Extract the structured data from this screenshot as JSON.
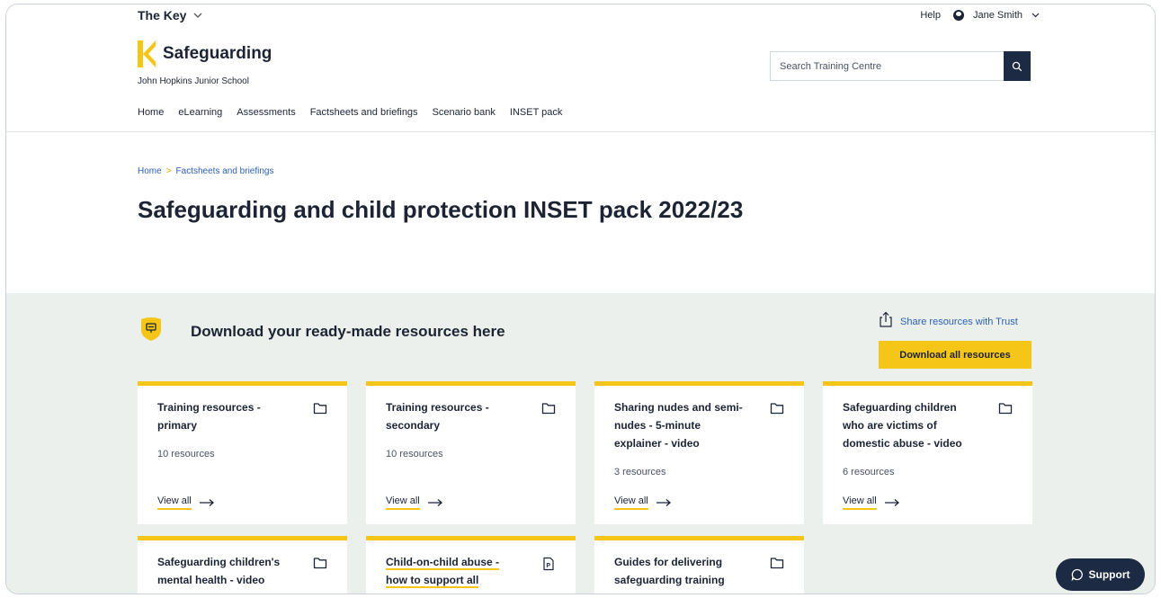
{
  "topbar": {
    "brand": "The Key",
    "help": "Help",
    "user_name": "Jane Smith"
  },
  "header": {
    "logo_title": "Safeguarding",
    "school": "John Hopkins Junior School",
    "search_placeholder": "Search Training Centre"
  },
  "nav": [
    "Home",
    "eLearning",
    "Assessments",
    "Factsheets and briefings",
    "Scenario bank",
    "INSET pack"
  ],
  "breadcrumb": {
    "home": "Home",
    "separator": ">",
    "current": "Factsheets and briefings"
  },
  "page": {
    "title": "Safeguarding and child protection INSET pack 2022/23"
  },
  "resources": {
    "heading": "Download your ready-made resources here",
    "share": "Share resources with Trust",
    "download_all": "Download all resources",
    "view_all": "View all",
    "cards": [
      {
        "title": "Training resources - primary",
        "count": "10 resources",
        "icon": "folder-icon"
      },
      {
        "title": "Training resources - secondary",
        "count": "10 resources",
        "icon": "folder-icon"
      },
      {
        "title": "Sharing nudes and semi-nudes - 5-minute explainer - video",
        "count": "3 resources",
        "icon": "folder-icon"
      },
      {
        "title": "Safeguarding children who are victims of domestic abuse - video",
        "count": "6 resources",
        "icon": "folder-icon"
      },
      {
        "title": "Safeguarding children's mental health - video",
        "icon": "folder-icon"
      },
      {
        "title": "Child-on-child abuse - how to support all children involved - video",
        "icon": "pdf-file-icon"
      },
      {
        "title": "Guides for delivering safeguarding training remotely",
        "icon": "folder-icon"
      }
    ]
  },
  "support": {
    "label": "Support"
  },
  "colors": {
    "accent": "#f5c518",
    "navy": "#1c2a44",
    "link": "#2c5fb6",
    "band": "#ebf0ec"
  }
}
